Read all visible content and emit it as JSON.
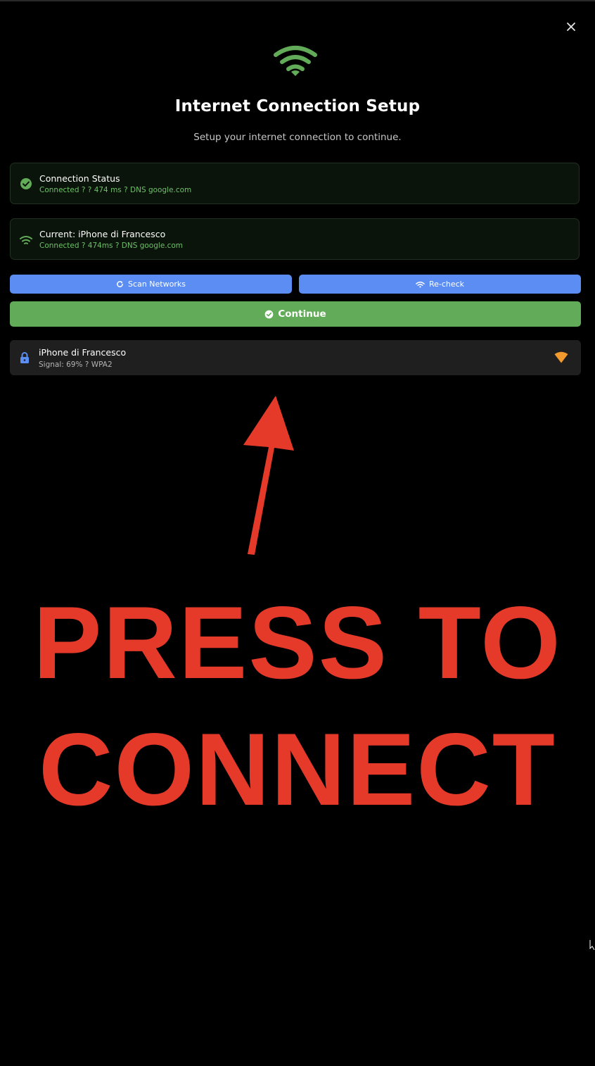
{
  "dialog": {
    "title": "Internet Connection Setup",
    "subtitle": "Setup your internet connection to continue.",
    "close_icon": "close-icon",
    "header_icon": "wifi-icon"
  },
  "status_card": {
    "title": "Connection Status",
    "detail": "Connected ? ? 474 ms ? DNS google.com",
    "icon": "check-circle-icon"
  },
  "current_card": {
    "title": "Current: iPhone di Francesco",
    "detail": "Connected ? 474ms ? DNS google.com",
    "icon": "wifi-icon"
  },
  "actions": {
    "scan_label": "Scan Networks",
    "recheck_label": "Re-check",
    "continue_label": "Continue"
  },
  "networks": [
    {
      "name": "iPhone di Francesco",
      "detail": "Signal: 69% ? WPA2",
      "icon": "lock-icon",
      "signal_icon": "signal-icon"
    }
  ],
  "annotation": {
    "line1": "PRESS TO",
    "line2": "CONNECT",
    "color": "#e53a2a"
  },
  "colors": {
    "accent_green": "#62ab58",
    "accent_blue": "#5b8df2",
    "status_text": "#6fbf6a",
    "signal_orange": "#f29a2e"
  }
}
